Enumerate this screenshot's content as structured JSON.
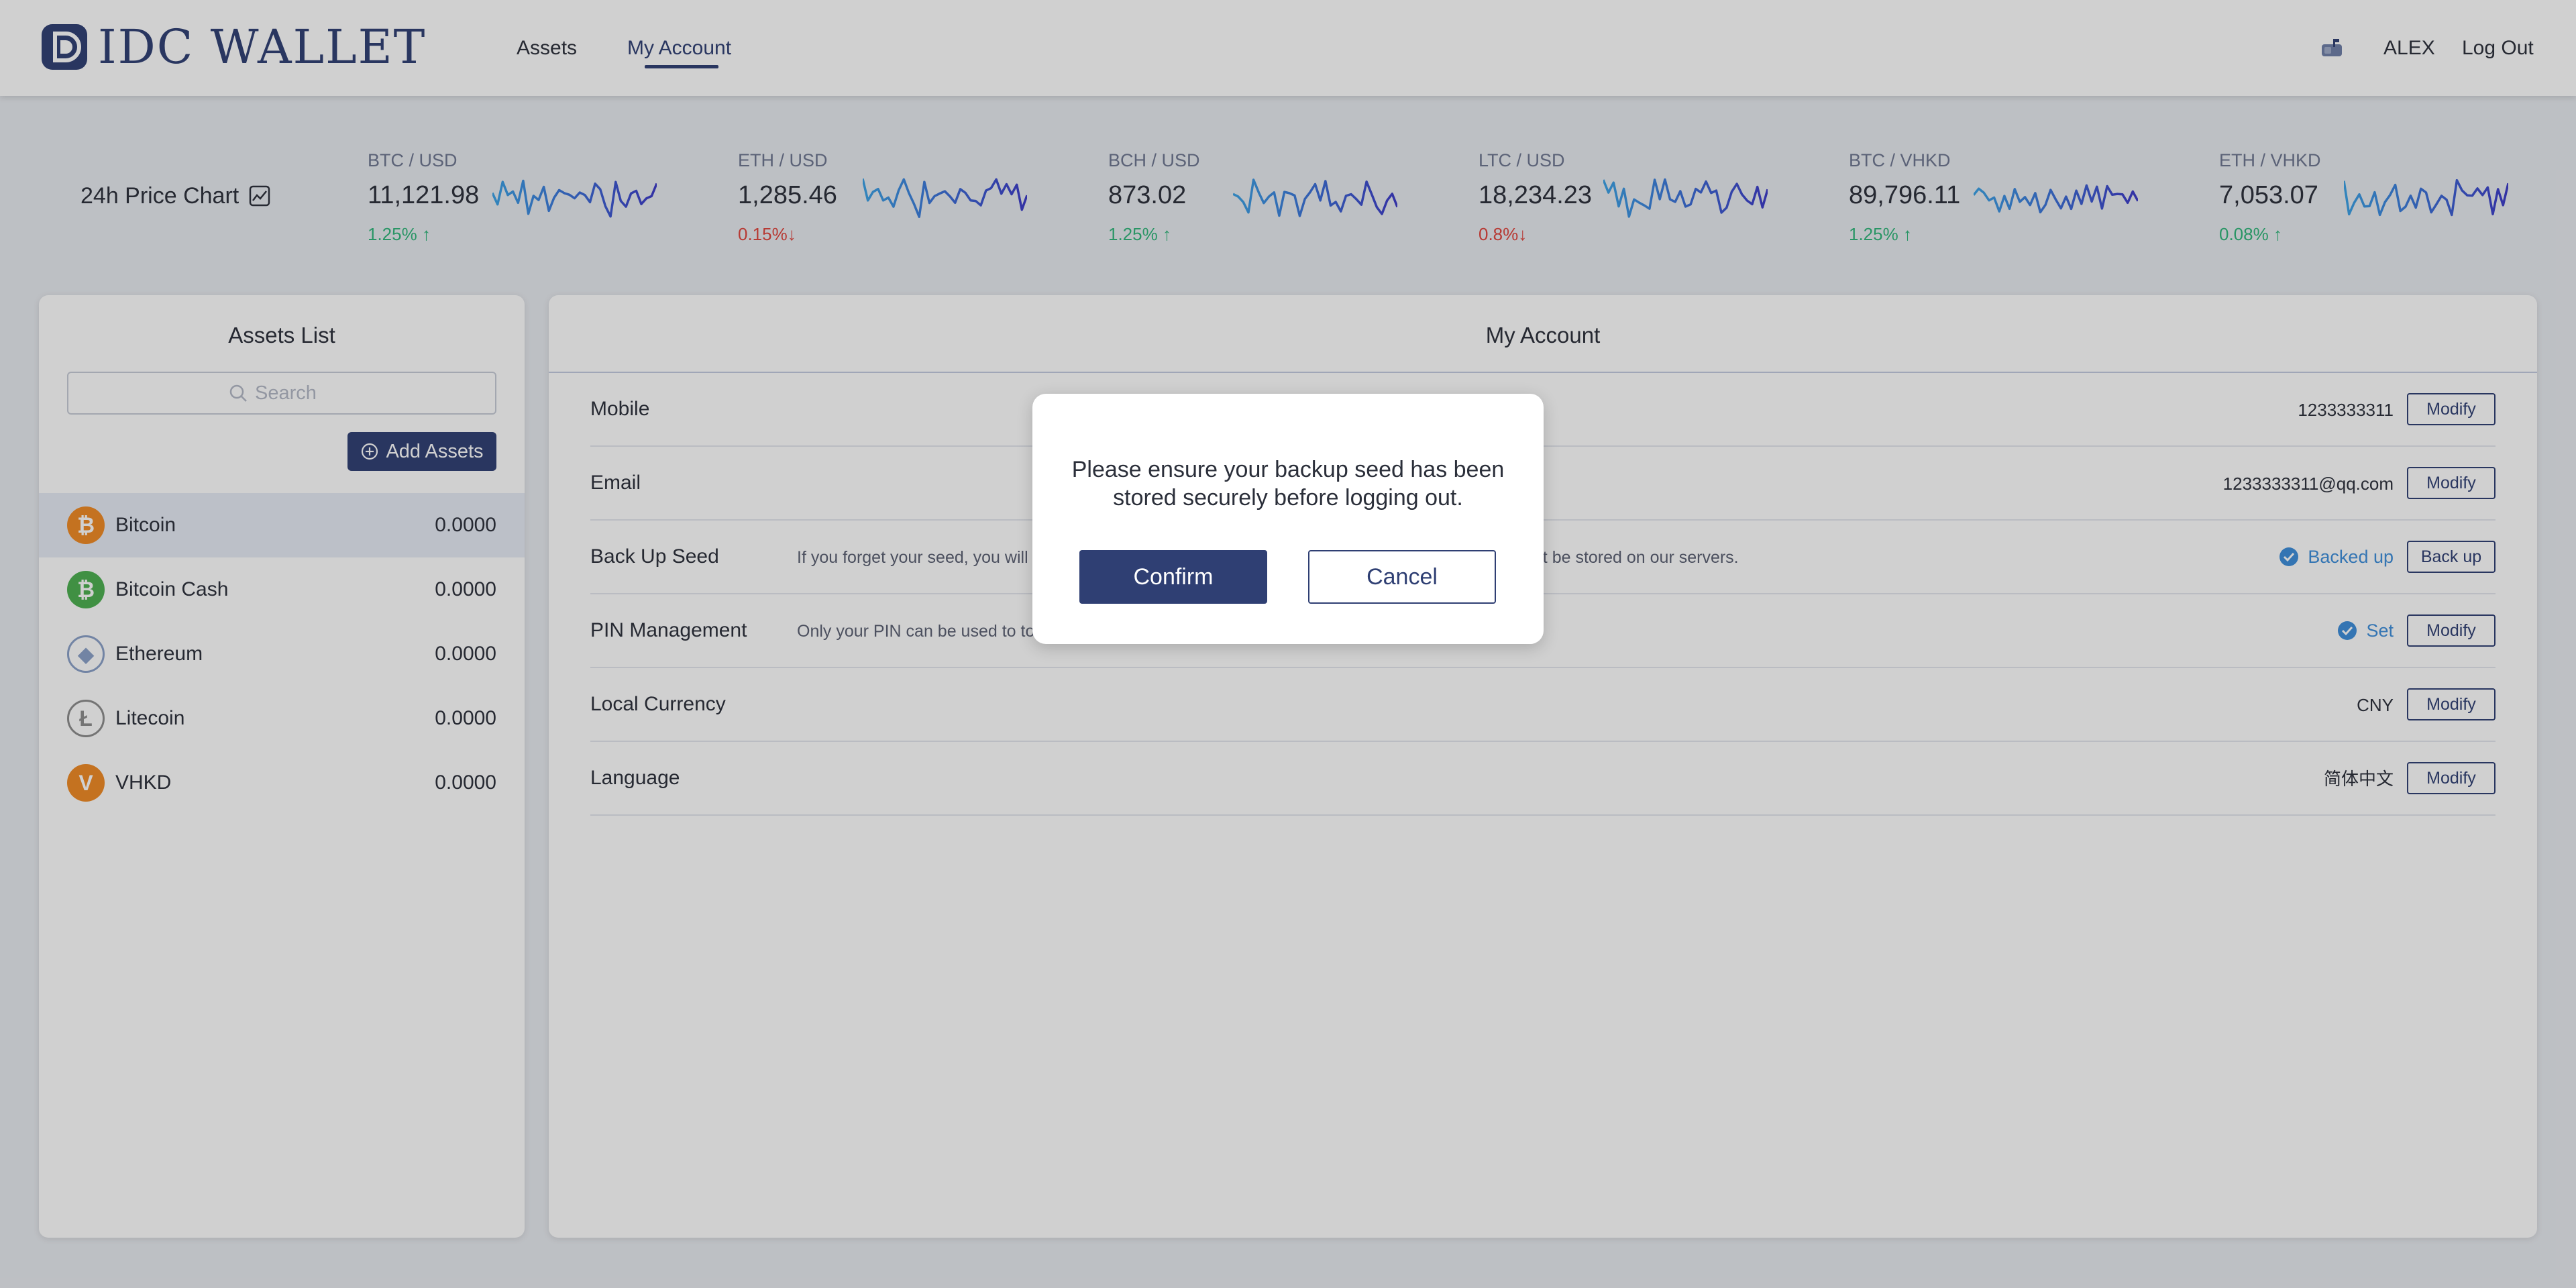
{
  "header": {
    "logo_text": "IDC WALLET",
    "nav": [
      {
        "label": "Assets"
      },
      {
        "label": "My Account"
      }
    ],
    "user": "ALEX",
    "logout": "Log Out",
    "message_icon": "mailbox-icon"
  },
  "ticker": {
    "title": "24h Price Chart",
    "title_icon": "chart-icon",
    "items": [
      {
        "pair": "BTC / USD",
        "price": "11,121.98",
        "change": "1.25%",
        "dir": "up"
      },
      {
        "pair": "ETH / USD",
        "price": "1,285.46",
        "change": "0.15%",
        "dir": "down"
      },
      {
        "pair": "BCH / USD",
        "price": "873.02",
        "change": "1.25%",
        "dir": "up"
      },
      {
        "pair": "LTC / USD",
        "price": "18,234.23",
        "change": "0.8%",
        "dir": "down"
      },
      {
        "pair": "BTC / VHKD",
        "price": "89,796.11",
        "change": "1.25%",
        "dir": "up"
      },
      {
        "pair": "ETH / VHKD",
        "price": "7,053.07",
        "change": "0.08%",
        "dir": "up"
      }
    ]
  },
  "assets_panel": {
    "title": "Assets List",
    "search_placeholder": "Search",
    "add_label": "Add Assets",
    "items": [
      {
        "name": "Bitcoin",
        "balance": "0.0000",
        "icon": "bitcoin-icon",
        "color": "#f08a24",
        "selected": true
      },
      {
        "name": "Bitcoin Cash",
        "balance": "0.0000",
        "icon": "bitcoin-cash-icon",
        "color": "#4cb04f",
        "selected": false
      },
      {
        "name": "Ethereum",
        "balance": "0.0000",
        "icon": "ethereum-icon",
        "color": "#8aa0c8",
        "selected": false
      },
      {
        "name": "Litecoin",
        "balance": "0.0000",
        "icon": "litecoin-icon",
        "color": "#8c8c8c",
        "selected": false
      },
      {
        "name": "VHKD",
        "balance": "0.0000",
        "icon": "vhkd-icon",
        "color": "#f08a24",
        "selected": false
      }
    ]
  },
  "account_panel": {
    "title": "My Account",
    "rows": [
      {
        "label": "Mobile",
        "desc": "",
        "value": "1233333311",
        "status": "",
        "button": "Modify"
      },
      {
        "label": "Email",
        "desc": "",
        "value": "1233333311@qq.com",
        "status": "",
        "button": "Modify"
      },
      {
        "label": "Back Up Seed",
        "desc": "If you forget your seed, you will l",
        "desc_tail": "not be stored on our servers.",
        "value": "",
        "status": "Backed up",
        "button": "Back up"
      },
      {
        "label": "PIN Management",
        "desc": "Only your PIN can be used to to",
        "desc_tail": "allet.",
        "value": "",
        "status": "Set",
        "button": "Modify"
      },
      {
        "label": "Local Currency",
        "desc": "",
        "value": "CNY",
        "status": "",
        "button": "Modify"
      },
      {
        "label": "Language",
        "desc": "",
        "value": "简体中文",
        "status": "",
        "button": "Modify"
      }
    ]
  },
  "modal": {
    "message": "Please ensure your backup seed has been stored securely before logging out.",
    "confirm": "Confirm",
    "cancel": "Cancel"
  },
  "colors": {
    "brand": "#2f3f73",
    "up": "#2fb67a",
    "down": "#e0443c",
    "status": "#3d8edb"
  }
}
